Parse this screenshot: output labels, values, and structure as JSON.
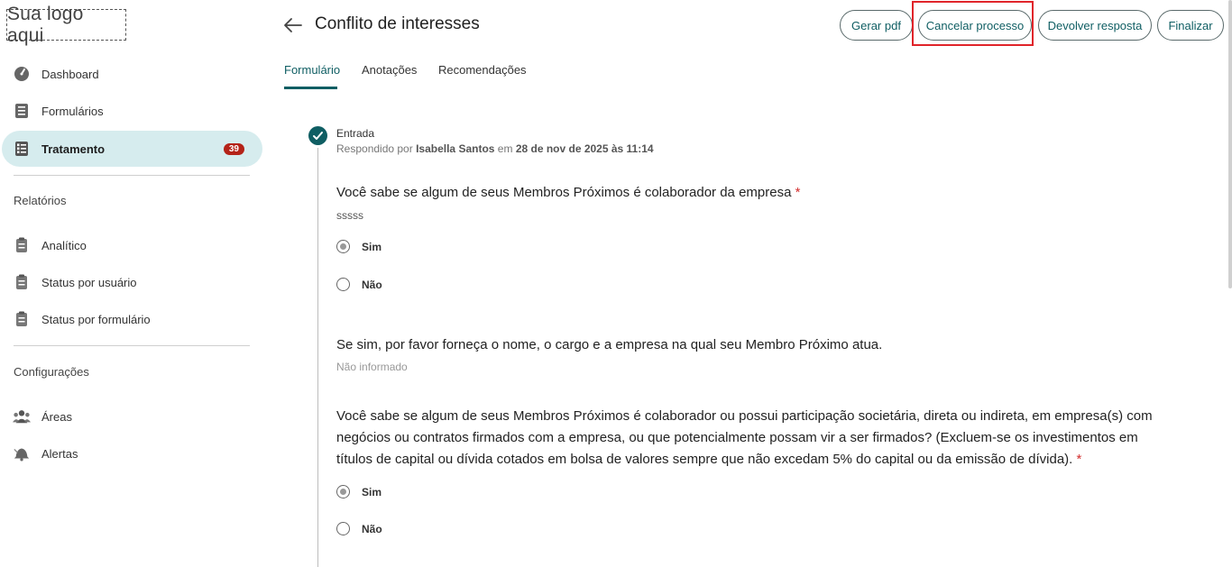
{
  "sidebar": {
    "logo": "Sua logo aqui",
    "items": [
      {
        "label": "Dashboard",
        "icon": "gauge-icon"
      },
      {
        "label": "Formulários",
        "icon": "list-icon"
      },
      {
        "label": "Tratamento",
        "icon": "checklist-icon",
        "badge": "39",
        "active": true
      }
    ],
    "sections": [
      {
        "title": "Relatórios",
        "items": [
          {
            "label": "Analítico",
            "icon": "clipboard-icon"
          },
          {
            "label": "Status por usuário",
            "icon": "clipboard-icon"
          },
          {
            "label": "Status por formulário",
            "icon": "clipboard-icon"
          }
        ]
      },
      {
        "title": "Configurações",
        "items": [
          {
            "label": "Áreas",
            "icon": "people-icon"
          },
          {
            "label": "Alertas",
            "icon": "bell-icon"
          }
        ]
      }
    ]
  },
  "header": {
    "title": "Conflito de interesses",
    "buttons": {
      "gerar_pdf": "Gerar pdf",
      "cancelar": "Cancelar processo",
      "devolver": "Devolver resposta",
      "finalizar": "Finalizar"
    }
  },
  "tabs": [
    {
      "label": "Formulário",
      "active": true
    },
    {
      "label": "Anotações"
    },
    {
      "label": "Recomendações"
    }
  ],
  "step": {
    "title": "Entrada",
    "meta_prefix": "Respondido por",
    "user": "Isabella Santos",
    "meta_mid": "em",
    "date": "28 de nov de 2025 às 11:14"
  },
  "questions": [
    {
      "text": "Você sabe se algum de seus Membros Próximos é colaborador da empresa",
      "required": "*",
      "answer": "sssss",
      "options": [
        "Sim",
        "Não"
      ],
      "selected": "Sim"
    },
    {
      "text": "Se sim, por favor forneça o nome, o cargo e a empresa na qual seu Membro Próximo atua.",
      "answer": "Não informado"
    },
    {
      "text": "Você sabe se algum de seus Membros Próximos é colaborador ou possui participação societária, direta ou indireta, em empresa(s) com negócios ou contratos firmados com a empresa, ou que potencialmente possam vir a ser firmados? (Excluem-se os investimentos em títulos de capital ou dívida cotados em bolsa de valores sempre que não excedam 5% do capital ou da emissão de dívida).",
      "required": "*",
      "options": [
        "Sim",
        "Não"
      ],
      "selected": "Sim"
    }
  ],
  "colors": {
    "accent": "#0f5e63",
    "active_bg": "#d6ecee",
    "badge": "#b42318",
    "highlight": "#e0242a"
  }
}
